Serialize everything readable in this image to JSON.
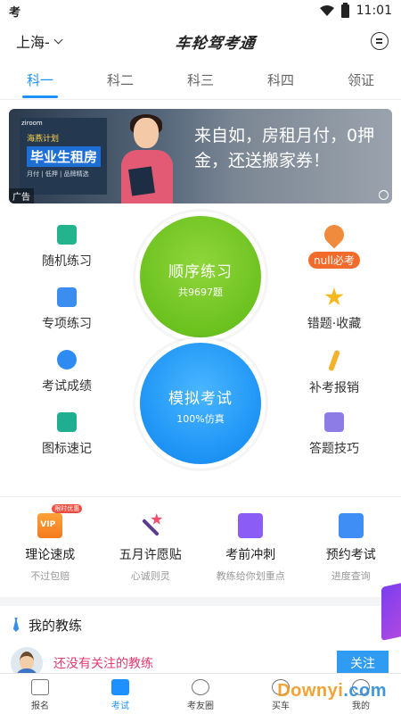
{
  "status_bar": {
    "left_text": "考",
    "time": "11:01"
  },
  "header": {
    "city": "上海-",
    "app_title": "车轮驾考通"
  },
  "tabs": [
    {
      "label": "科一"
    },
    {
      "label": "科二"
    },
    {
      "label": "科三"
    },
    {
      "label": "科四"
    },
    {
      "label": "领证"
    }
  ],
  "banner": {
    "poster_top": "海燕计划",
    "poster_big": "毕业生租房",
    "poster_sub": "月付 | 低押 | 品牌精选",
    "poster_brand": "ziroom",
    "slogan": "来自如，房租月付，0押金，还送搬家券！",
    "ad_label": "广告"
  },
  "practice": {
    "left": [
      {
        "label": "随机练习"
      },
      {
        "label": "专项练习"
      },
      {
        "label": "考试成绩"
      },
      {
        "label": "图标速记"
      }
    ],
    "right": [
      {
        "label": "null必考"
      },
      {
        "label": "错题·收藏"
      },
      {
        "label": "补考报销"
      },
      {
        "label": "答题技巧"
      }
    ],
    "sequential": {
      "title": "顺序练习",
      "sub": "共9697题"
    },
    "mock": {
      "title": "模拟考试",
      "sub": "100%仿真"
    }
  },
  "services": [
    {
      "title": "理论速成",
      "sub": "不过包赔",
      "badge": "限时优惠"
    },
    {
      "title": "五月许愿贴",
      "sub": "心诚则灵"
    },
    {
      "title": "考前冲刺",
      "sub": "教练给你划重点"
    },
    {
      "title": "预约考试",
      "sub": "进度查询"
    }
  ],
  "coach": {
    "heading": "我的教练",
    "empty_text": "还没有关注的教练",
    "follow_label": "关注"
  },
  "bottom_nav": [
    {
      "label": "报名"
    },
    {
      "label": "考试"
    },
    {
      "label": "考友圈"
    },
    {
      "label": "买车"
    },
    {
      "label": "我的"
    }
  ],
  "watermark": {
    "main": "Downyi",
    "tld": ".com"
  },
  "colors": {
    "accent": "#1e90ff",
    "green_circle": "#6cc21f",
    "blue_circle": "#1d93f5",
    "coach_text": "#e23b70"
  }
}
